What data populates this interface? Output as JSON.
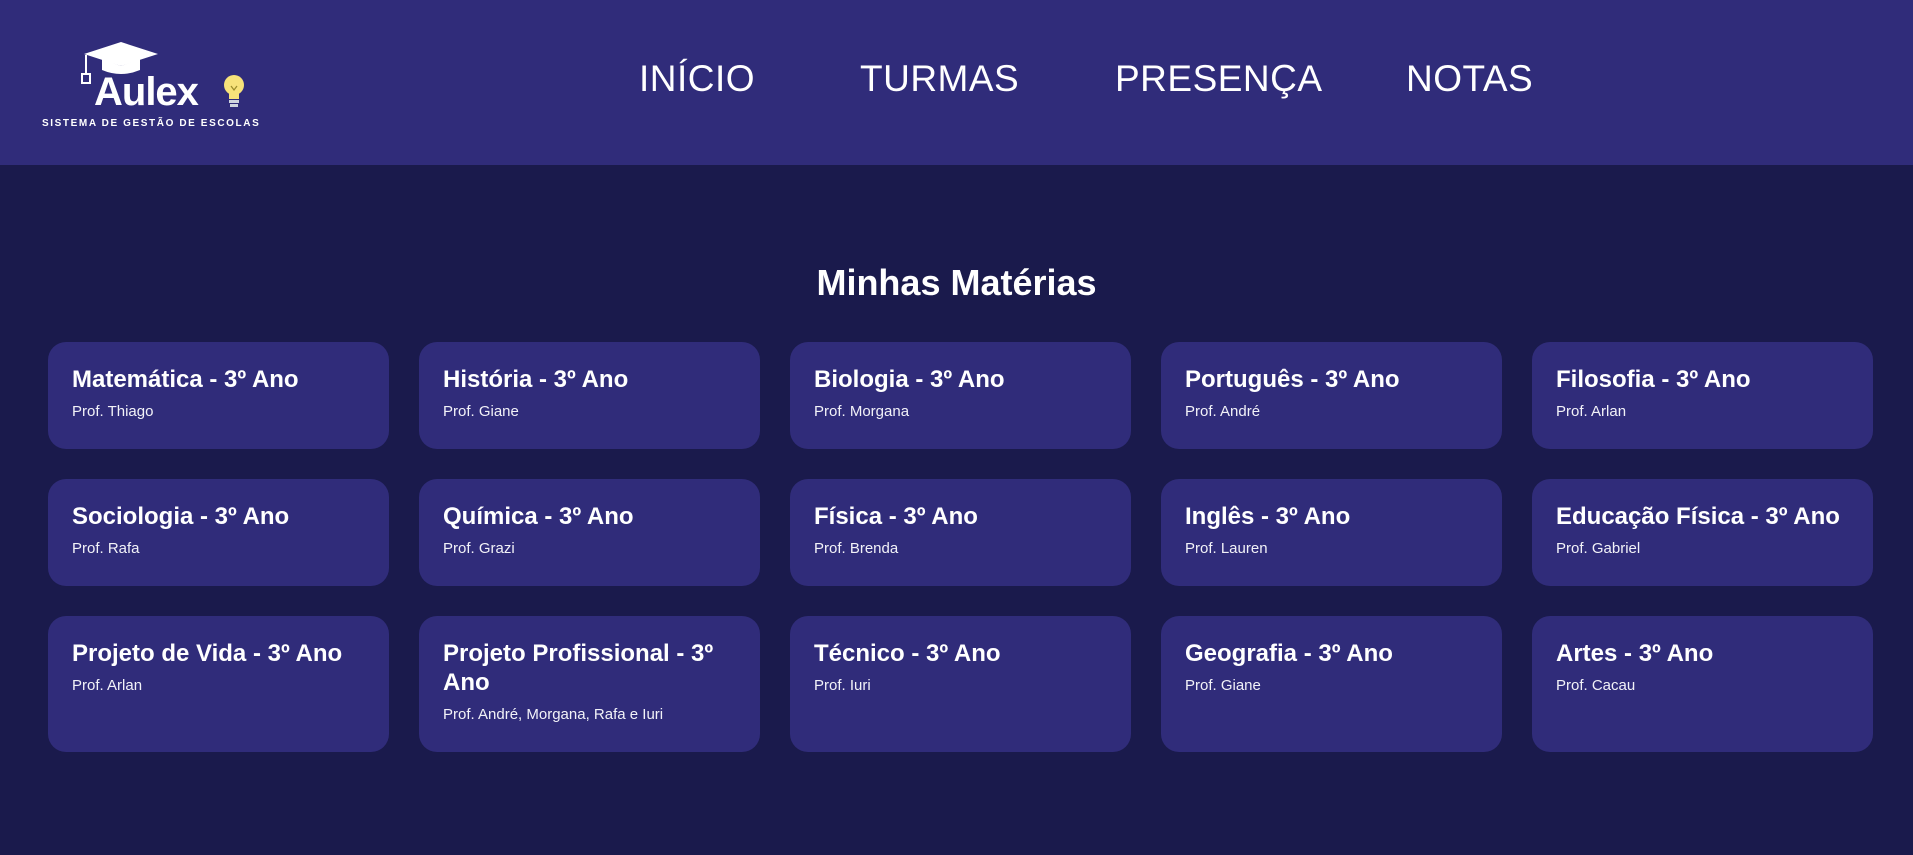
{
  "header": {
    "logo": {
      "word": "Aulex",
      "subtitle": "SISTEMA DE GESTÃO DE ESCOLAS",
      "icons": [
        "graduation-cap-icon",
        "light-bulb-icon"
      ]
    },
    "nav": [
      {
        "label": "INÍCIO"
      },
      {
        "label": "TURMAS"
      },
      {
        "label": "PRESENÇA"
      },
      {
        "label": "NOTAS"
      }
    ]
  },
  "main": {
    "title": "Minhas Matérias",
    "subjects": [
      {
        "title": "Matemática - 3º Ano",
        "professor": "Prof. Thiago"
      },
      {
        "title": "História - 3º Ano",
        "professor": "Prof. Giane"
      },
      {
        "title": "Biologia - 3º Ano",
        "professor": "Prof. Morgana"
      },
      {
        "title": "Português - 3º Ano",
        "professor": "Prof. André"
      },
      {
        "title": "Filosofia - 3º Ano",
        "professor": "Prof. Arlan"
      },
      {
        "title": "Sociologia - 3º Ano",
        "professor": "Prof. Rafa"
      },
      {
        "title": "Química - 3º Ano",
        "professor": "Prof. Grazi"
      },
      {
        "title": "Física - 3º Ano",
        "professor": "Prof. Brenda"
      },
      {
        "title": "Inglês - 3º Ano",
        "professor": "Prof. Lauren"
      },
      {
        "title": "Educação Física - 3º Ano",
        "professor": "Prof. Gabriel"
      },
      {
        "title": "Projeto de Vida - 3º Ano",
        "professor": "Prof. Arlan"
      },
      {
        "title": "Projeto Profissional - 3º Ano",
        "professor": "Prof. André, Morgana, Rafa e Iuri"
      },
      {
        "title": "Técnico - 3º Ano",
        "professor": "Prof. Iuri"
      },
      {
        "title": "Geografia - 3º Ano",
        "professor": "Prof. Giane"
      },
      {
        "title": "Artes - 3º Ano",
        "professor": "Prof. Cacau"
      }
    ]
  },
  "colors": {
    "background": "#1a1a4c",
    "header": "#302c7a",
    "card": "#302c7a",
    "text": "#ffffff",
    "bulb": "#f7e27a"
  }
}
